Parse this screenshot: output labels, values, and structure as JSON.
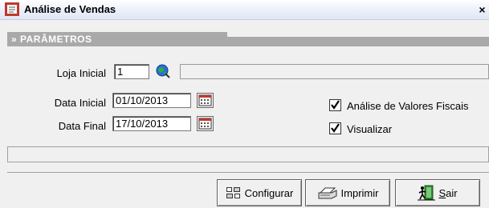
{
  "window": {
    "title": "Análise de Vendas",
    "close_glyph": "×"
  },
  "section": {
    "title": "» PARÂMETROS"
  },
  "form": {
    "loja_inicial_label": "Loja Inicial",
    "loja_inicial_value": "1",
    "data_inicial_label": "Data Inicial",
    "data_inicial_value": "01/10/2013",
    "data_final_label": "Data Final",
    "data_final_value": "17/10/2013"
  },
  "options": {
    "analise_label": "Análise de Valores Fiscais",
    "analise_checked": true,
    "visualizar_label": "Visualizar",
    "visualizar_checked": true
  },
  "buttons": {
    "configurar_label": "Configurar",
    "imprimir_label": "Imprimir",
    "sair_first": "S",
    "sair_rest": "air"
  },
  "icons": {
    "app": "report-app-icon",
    "search": "globe-search-icon",
    "calendar": "calendar-icon",
    "configure": "configure-icon",
    "print": "printer-icon",
    "exit": "exit-door-icon"
  },
  "colors": {
    "section_bar": "#a9a9a9",
    "accent_green": "#2e8b2e"
  }
}
